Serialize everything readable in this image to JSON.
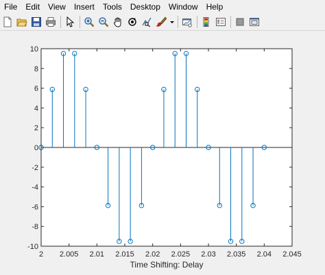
{
  "menu": [
    "File",
    "Edit",
    "View",
    "Insert",
    "Tools",
    "Desktop",
    "Window",
    "Help"
  ],
  "toolbar": [
    "new-figure-icon",
    "open-file-icon",
    "save-icon",
    "print-icon",
    "|",
    "select-arrow-icon",
    "|",
    "zoom-in-icon",
    "zoom-out-icon",
    "pan-hand-icon",
    "rotate-3d-icon",
    "data-cursor-icon",
    "brush-icon",
    "brush-dropdown-icon",
    "|",
    "link-plot-icon",
    "|",
    "colorbar-icon",
    "legend-icon",
    "|",
    "hide-plot-tools-icon",
    "show-plot-tools-icon"
  ],
  "chart_data": {
    "type": "stem",
    "x": [
      2.0,
      2.002,
      2.004,
      2.006,
      2.008,
      2.01,
      2.012,
      2.014,
      2.016,
      2.018,
      2.02,
      2.022,
      2.024,
      2.026,
      2.028,
      2.03,
      2.032,
      2.034,
      2.036,
      2.038,
      2.04
    ],
    "values": [
      0,
      5.88,
      9.51,
      9.51,
      5.88,
      0,
      -5.88,
      -9.51,
      -9.51,
      -5.88,
      0,
      5.88,
      9.51,
      9.51,
      5.88,
      0,
      -5.88,
      -9.51,
      -9.51,
      -5.88,
      0
    ],
    "xlim": [
      2.0,
      2.045
    ],
    "ylim": [
      -10,
      10
    ],
    "xticks": [
      "2",
      "2.005",
      "2.01",
      "2.015",
      "2.02",
      "2.025",
      "2.03",
      "2.035",
      "2.04",
      "2.045"
    ],
    "xtick_values": [
      2.0,
      2.005,
      2.01,
      2.015,
      2.02,
      2.025,
      2.03,
      2.035,
      2.04,
      2.045
    ],
    "yticks": [
      "10",
      "8",
      "6",
      "4",
      "2",
      "0",
      "-2",
      "-4",
      "-6",
      "-8",
      "-10"
    ],
    "ytick_values": [
      10,
      8,
      6,
      4,
      2,
      0,
      -2,
      -4,
      -6,
      -8,
      -10
    ],
    "xlabel": "Time Shifting: Delay",
    "ylabel": "",
    "title": "",
    "grid": false,
    "color": "#0072bd"
  }
}
